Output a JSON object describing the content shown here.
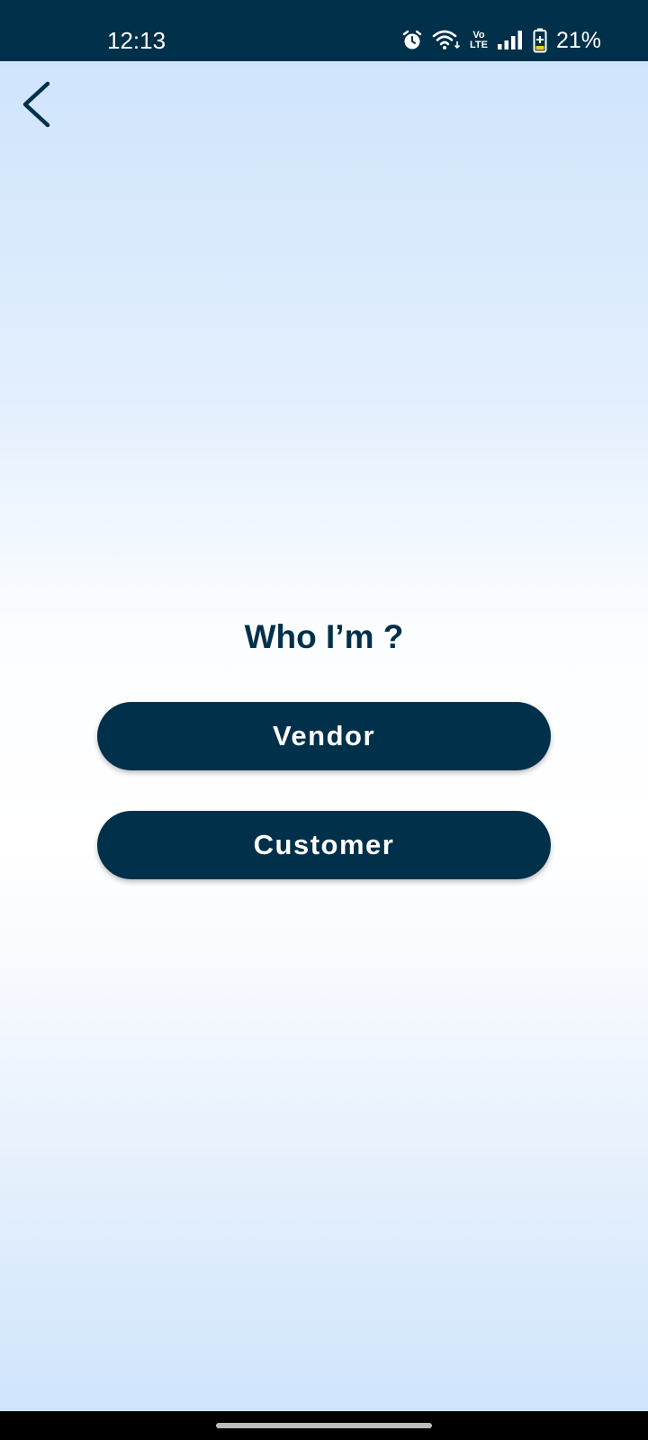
{
  "status_bar": {
    "time": "12:13",
    "network_label_top": "Vo",
    "network_label_bottom": "LTE",
    "battery_percent": "21%",
    "icons": [
      "alarm-icon",
      "wifi-icon",
      "volte-icon",
      "signal-icon",
      "battery-icon"
    ]
  },
  "header": {
    "back_icon": "chevron-left-icon"
  },
  "main": {
    "title": "Who I’m ?",
    "options": [
      {
        "label": "Vendor"
      },
      {
        "label": "Customer"
      }
    ]
  },
  "colors": {
    "primary": "#01304a",
    "background_top": "#cfe4fc",
    "background_mid": "#ffffff",
    "button_text": "#ffffff"
  }
}
